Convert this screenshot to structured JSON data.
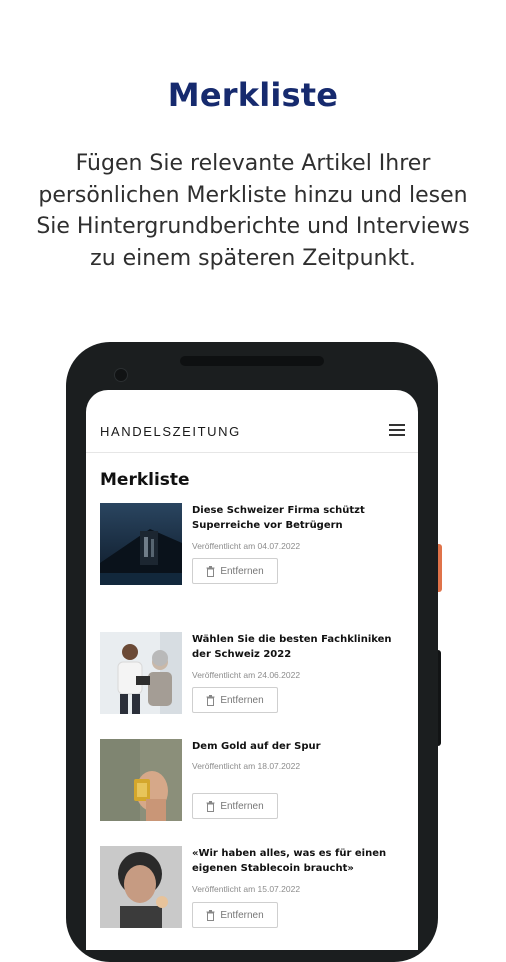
{
  "promo": {
    "title": "Merkliste",
    "description_lines": [
      "Fügen Sie relevante Artikel Ihrer",
      "persönlichen Merkliste hinzu und lesen",
      "Sie Hintergrundberichte und Interviews",
      "zu einem späteren Zeitpunkt."
    ]
  },
  "app": {
    "brand": "HANDELSZEITUNG",
    "menu_icon": "hamburger-menu-icon",
    "page_title": "Merkliste",
    "articles": [
      {
        "title": "Diese Schweizer Firma schützt Superreiche vor Betrügern",
        "date": "Veröffentlicht am 04.07.2022",
        "remove_label": "Entfernen"
      },
      {
        "title": "Wählen Sie die besten Fachkliniken der Schweiz 2022",
        "date": "Veröffentlicht am 24.06.2022",
        "remove_label": "Entfernen"
      },
      {
        "title": "Dem Gold auf der Spur",
        "date": "Veröffentlicht am 18.07.2022",
        "remove_label": "Entfernen"
      },
      {
        "title": "«Wir haben alles, was es für einen eigenen Stablecoin braucht»",
        "date": "Veröffentlicht am 15.07.2022",
        "remove_label": "Entfernen"
      }
    ]
  },
  "colors": {
    "promo_title": "#162a6e",
    "phone_body": "#1b1e1f",
    "side_button_accent": "#e0734a"
  }
}
